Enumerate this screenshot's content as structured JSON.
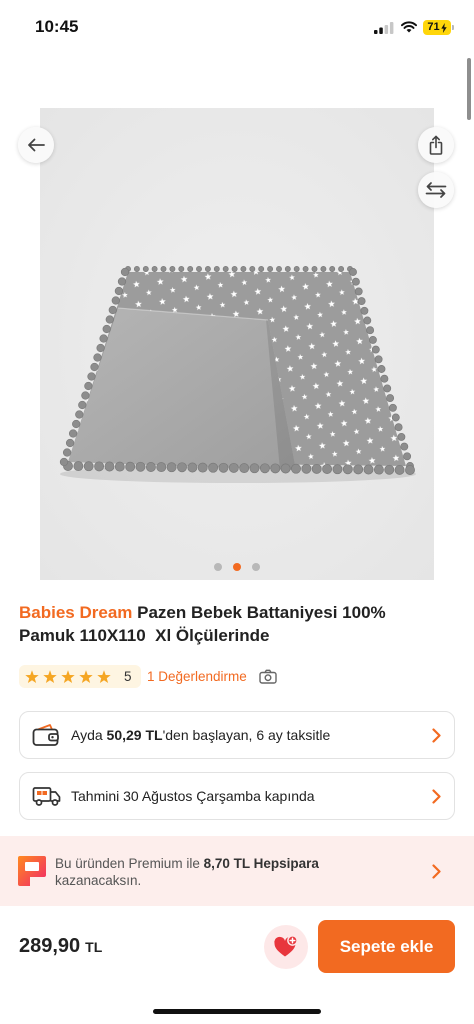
{
  "status_bar": {
    "time": "10:45",
    "battery_level": "71"
  },
  "icons": {
    "back": "arrow-left-icon",
    "share": "share-icon",
    "compare": "compare-arrows-icon",
    "rating": "star-icon",
    "camera": "camera-icon",
    "installment": "wallet-icon",
    "delivery": "truck-icon",
    "chevron": "chevron-right-icon",
    "hepsipara": "hepsipara-logo-icon",
    "favorite": "heart-plus-icon"
  },
  "gallery": {
    "image_count": 3,
    "active_index": 1
  },
  "product": {
    "brand": "Babies Dream",
    "name": "Pazen Bebek Battaniyesi 100% Pamuk 110X110  Xl Ölçülerinde"
  },
  "rating": {
    "stars": 5,
    "score": "5",
    "reviews_label": "1 Değerlendirme"
  },
  "installment": {
    "prefix": "Ayda ",
    "amount": "50,29 TL",
    "suffix": "'den başlayan, 6 ay taksitle"
  },
  "delivery": {
    "text": "Tahmini 30 Ağustos Çarşamba kapında"
  },
  "hepsipara": {
    "prefix": "Bu üründen Premium ile ",
    "amount": "8,70 TL Hepsipara",
    "suffix": " kazanacaksın."
  },
  "footer": {
    "price": "289,90",
    "currency": "TL",
    "add_to_cart_label": "Sepete ekle"
  },
  "colors": {
    "accent": "#F26A21",
    "rating_star": "#F5A623",
    "banner_background": "#FDEEEC",
    "favorite_heart": "#E8363D",
    "battery": "#FFD60A"
  }
}
